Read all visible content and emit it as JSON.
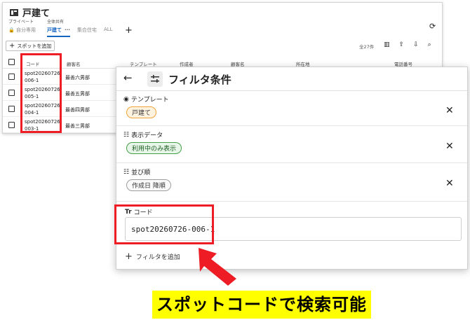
{
  "window": {
    "title": "戸建て",
    "tab_groups": [
      {
        "label": "プライベート",
        "tabs": [
          {
            "label": "自分専用",
            "active": false
          }
        ]
      },
      {
        "label": "全体共有",
        "tabs": [
          {
            "label": "戸建て",
            "active": true
          },
          {
            "label": "集合住宅",
            "active": false
          },
          {
            "label": "ALL",
            "active": false
          }
        ]
      }
    ],
    "tab_more": "···",
    "add_tab": "+",
    "add_spot_label": "スポットを追加",
    "count_label": "全27件",
    "columns": [
      "コード",
      "顧客名",
      "テンプレート",
      "作成者",
      "顧客名",
      "所在地",
      "電話番号"
    ],
    "rows": [
      {
        "code": "spot20260726-006-1",
        "customer": "最善六男部"
      },
      {
        "code": "spot20260726-005-1",
        "customer": "最善五男部"
      },
      {
        "code": "spot20260726-004-1",
        "customer": "最善四男部"
      },
      {
        "code": "spot20260726-003-1",
        "customer": "最善三男部"
      }
    ]
  },
  "filter_panel": {
    "title": "フィルタ条件",
    "sections": [
      {
        "label": "テンプレート",
        "icon": "radio-icon",
        "chip": "戸建て",
        "chip_color": "#f0a33a"
      },
      {
        "label": "表示データ",
        "icon": "checklist-icon",
        "chip": "利用中のみ表示",
        "chip_color": "#43a047"
      },
      {
        "label": "並び順",
        "icon": "checklist-icon",
        "chip": "作成日 降順",
        "chip_color": "#9e9e9e"
      }
    ],
    "code_section": {
      "label": "コード",
      "value": "spot20260726-006-1"
    },
    "add_filter_label": "フィルタを追加"
  },
  "annotation": {
    "caption": "スポットコードで検索可能",
    "highlight_color": "#ee1c24",
    "caption_bg": "#ffff00"
  }
}
